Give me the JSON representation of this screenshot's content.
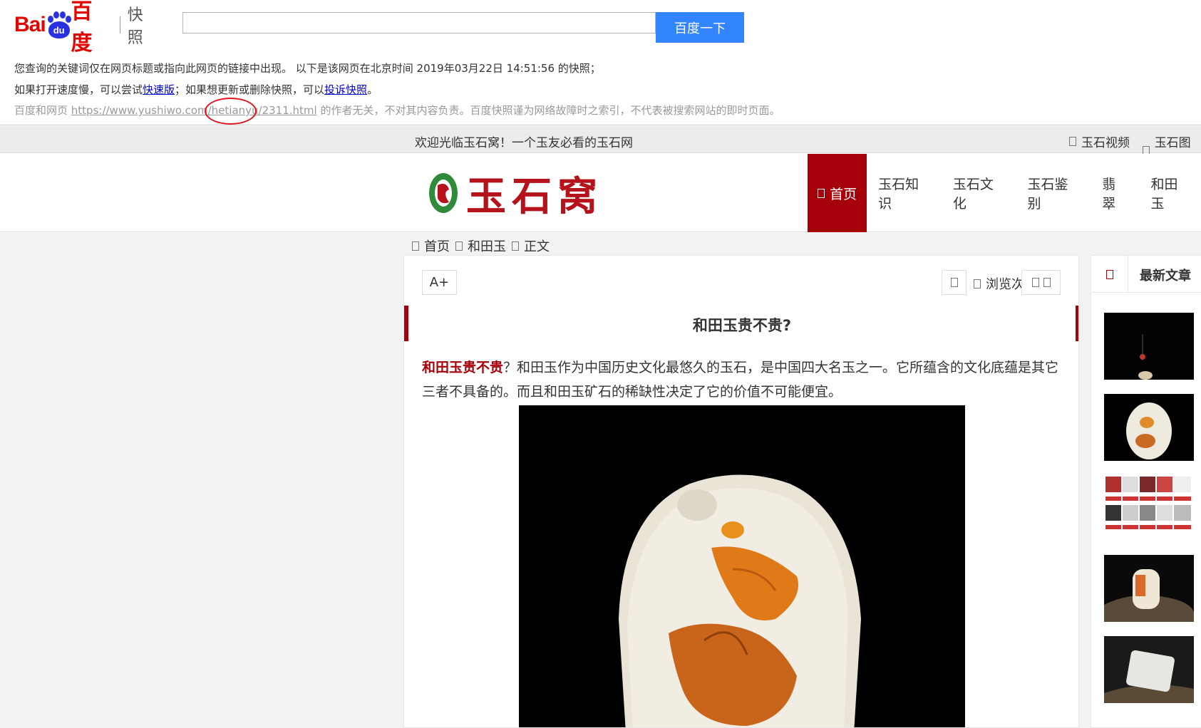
{
  "baidu": {
    "logo_bai": "Bai",
    "logo_du": "du",
    "logo_baidu": "百度",
    "logo_kuaizhao": "快照",
    "search_value": "",
    "search_button": "百度一下",
    "notice_line1": "您查询的关键词仅在网页标题或指向此网页的链接中出现。  以下是该网页在北京时间 2019年03月22日 14:51:56 的快照；",
    "notice_line2_a": "如果打开速度慢，可以尝试",
    "notice_line2_link1": "快速版",
    "notice_line2_b": "；如果想更新或删除快照，可以",
    "notice_line2_link2": "投诉快照",
    "notice_line2_c": "。",
    "notice_line3_a": "百度和网页 ",
    "notice_line3_url": "https://www.yushiwo.com/hetianyu/2311.html",
    "notice_line3_b": " 的作者无关，不对其内容负责。百度快照谨为网络故障时之索引，不代表被搜索网站的即时页面。"
  },
  "topbar": {
    "welcome": "欢迎光临玉石窝！一个玉友必看的玉石网",
    "links": [
      "玉石视频",
      "玉石图片"
    ]
  },
  "site": {
    "logo_text": "玉石窝",
    "nav": [
      "首页",
      "玉石知识",
      "玉石文化",
      "玉石鉴别",
      "翡翠",
      "和田玉"
    ]
  },
  "breadcrumb": [
    "首页",
    "和田玉",
    "正文"
  ],
  "article": {
    "font_button": "A+",
    "views_label": "浏览次",
    "title": "和田玉贵不贵?",
    "lead_bold": "和田玉贵不贵",
    "lead_rest": "？和田玉作为中国历史文化最悠久的玉石，是中国四大名玉之一。它所蕴含的文化底蕴是其它三者不具备的。而且和田玉矿石的稀缺性决定了它的价值不可能便宜。"
  },
  "sidebar": {
    "title": "最新文章"
  },
  "colors": {
    "brand_red": "#a6000a",
    "baidu_blue": "#3385ff",
    "link_blue": "#0000cc"
  }
}
